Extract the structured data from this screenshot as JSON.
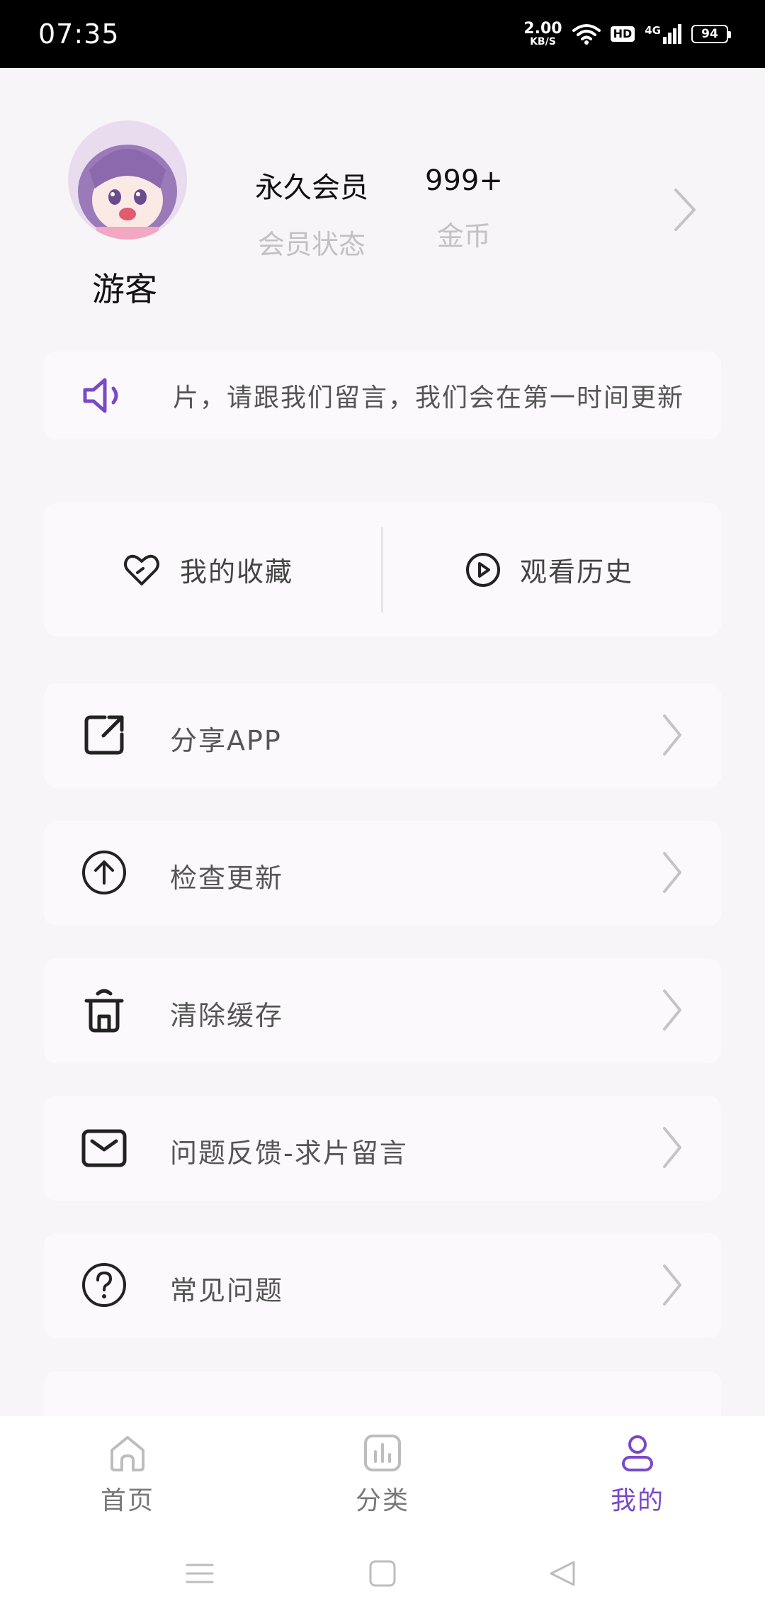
{
  "status_bar": {
    "time": "07:35",
    "net_speed_value": "2.00",
    "net_speed_unit": "KB/S",
    "hd": "HD",
    "network": "4G",
    "battery": "94"
  },
  "profile": {
    "name": "游客",
    "membership_value": "永久会员",
    "membership_label": "会员状态",
    "coins_value": "999+",
    "coins_label": "金币"
  },
  "notice": {
    "text": "片，请跟我们留言，我们会在第一时间更新"
  },
  "quick_actions": {
    "favorites": "我的收藏",
    "history": "观看历史"
  },
  "menu": {
    "items": [
      {
        "label": "分享APP",
        "icon": "share-icon"
      },
      {
        "label": "检查更新",
        "icon": "upload-icon"
      },
      {
        "label": "清除缓存",
        "icon": "trash-icon"
      },
      {
        "label": "问题反馈-求片留言",
        "icon": "mail-icon"
      },
      {
        "label": "常见问题",
        "icon": "help-icon"
      }
    ]
  },
  "bottom_nav": {
    "items": [
      {
        "label": "首页",
        "icon": "home-icon"
      },
      {
        "label": "分类",
        "icon": "category-icon"
      },
      {
        "label": "我的",
        "icon": "user-icon"
      }
    ],
    "active": "我的"
  },
  "colors": {
    "accent": "#7a49c8",
    "page_bg": "#f7f5f7",
    "card_bg": "#fbf9fb",
    "muted_text": "#c2c2c2"
  }
}
